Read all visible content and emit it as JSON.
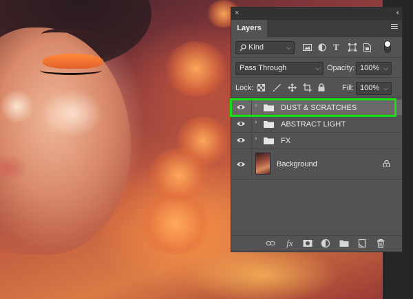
{
  "panel": {
    "tab_label": "Layers",
    "close_glyph": "×",
    "collapse_glyph": "‹‹",
    "filter": {
      "kind_label": "Kind",
      "icons": [
        "image-filter-icon",
        "adjustment-filter-icon",
        "type-filter-icon",
        "shape-filter-icon",
        "smart-object-filter-icon",
        "filter-toggle-icon"
      ]
    },
    "blend_mode": "Pass Through",
    "opacity_label": "Opacity:",
    "opacity_value": "100%",
    "lock_label": "Lock:",
    "fill_label": "Fill:",
    "fill_value": "100%",
    "layers": [
      {
        "name": "DUST & SCRATCHES",
        "type": "group",
        "selected": true,
        "visible": true
      },
      {
        "name": "ABSTRACT LIGHT",
        "type": "group",
        "selected": false,
        "visible": true
      },
      {
        "name": "FX",
        "type": "group",
        "selected": false,
        "visible": true
      },
      {
        "name": "Background",
        "type": "image",
        "selected": false,
        "visible": true,
        "locked": true
      }
    ],
    "footer_icons": [
      "link-layers-icon",
      "fx-icon",
      "add-mask-icon",
      "adjustment-layer-icon",
      "new-group-icon",
      "new-layer-icon",
      "delete-layer-icon"
    ],
    "fx_label": "fx"
  },
  "colors": {
    "panel_bg": "#535353",
    "selected_row": "#696969",
    "highlight": "#14e014"
  }
}
